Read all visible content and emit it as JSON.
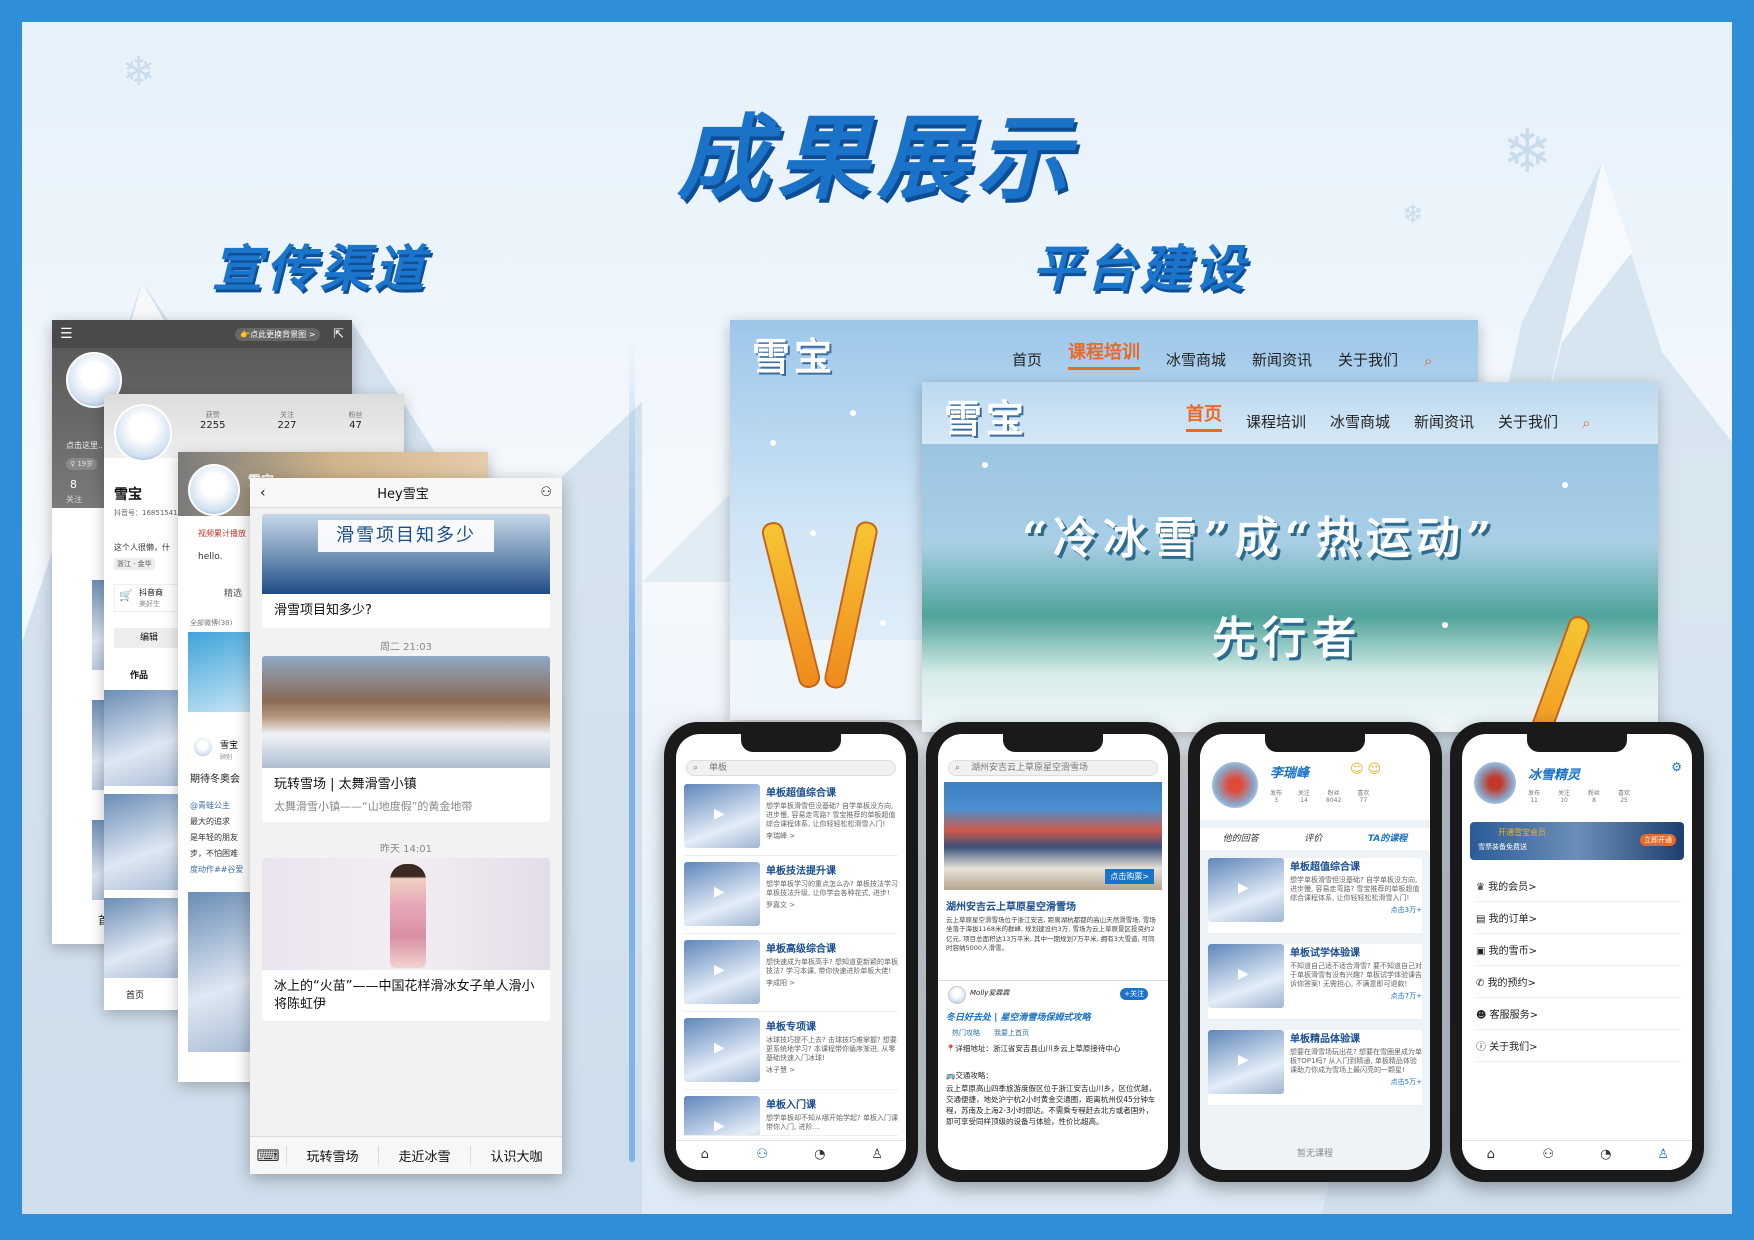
{
  "poster": {
    "main_title": "成果展示",
    "left_section_title": "宣传渠道",
    "right_section_title": "平台建设"
  },
  "social": {
    "profile1": {
      "menu_badge": "👉点此更换背景图 >",
      "hint": "点击这里...",
      "age": "♀ 19岁",
      "count": "8",
      "count_label": "关注",
      "nav_home": "首页"
    },
    "profile2": {
      "name": "雪宝",
      "id": "抖音号：16851541",
      "stats": [
        {
          "label": "获赞",
          "value": "2255"
        },
        {
          "label": "关注",
          "value": "227"
        },
        {
          "label": "粉丝",
          "value": "47"
        }
      ],
      "bio": "这个人很懒，什",
      "location": "浙江 · 金华",
      "shop": "抖音商",
      "shop_sub": "美好生",
      "edit": "编辑",
      "works": "作品",
      "nav_home": "首页"
    },
    "profile3": {
      "name": "雪宝",
      "badge": "视频累计播放",
      "hello": "hello.",
      "featured": "精选",
      "all_posts": "全部微博(38)",
      "post_name": "雪宝",
      "post_sub": "顾别",
      "post_line1": "期待冬奥会",
      "post_line2": "@青蛙公主",
      "post_line3": "最大的追求",
      "post_line4": "是年轻的朋友",
      "post_line5": "步，不怕困难",
      "post_line6": "度动作##谷爱"
    },
    "hey": {
      "title": "Hey雪宝",
      "article1_banner": "滑雪项目知多少",
      "article1_caption": "滑雪项目知多少?",
      "time1": "周二 21:03",
      "article2_caption": "玩转雪场 | 太舞滑雪小镇",
      "article2_sub": "太舞滑雪小镇——“山地度假”的黄金地带",
      "time2": "昨天 14:01",
      "article3_caption": "冰上的“火苗”——中国花样滑冰女子单人滑小将陈虹伊",
      "menus": [
        "玩转雪场",
        "走近冰雪",
        "认识大咖"
      ]
    }
  },
  "website_back": {
    "logo": "雪宝",
    "nav": [
      "首页",
      "课程培训",
      "冰雪商城",
      "新闻资讯",
      "关于我们"
    ],
    "active": "课程培训"
  },
  "website_front": {
    "logo": "雪宝",
    "nav": [
      "首页",
      "课程培训",
      "冰雪商城",
      "新闻资讯",
      "关于我们"
    ],
    "active": "首页",
    "hero_line1": "“冷冰雪”成“热运动”",
    "hero_line2": "先行者"
  },
  "phones": {
    "p1": {
      "search": "单板",
      "courses": [
        {
          "title": "单板超值综合课",
          "desc": "想学单板滑雪但没基础? 自学单板没方向, 进步慢, 容易走弯路? 雪宝推荐的单板超值综合课程体系, 让你轻轻松松滑雪入门!",
          "teacher": "李瑞峰 >"
        },
        {
          "title": "单板技法提升课",
          "desc": "想学单板学习的重点怎么办? 单板技法学习单板技法升级, 让你学会各种花式, 进步!",
          "teacher": "罗嘉文 >"
        },
        {
          "title": "单板高级综合课",
          "desc": "想快速成为单板高手? 想知道更新颖的单板技法? 学习本课, 带你快速进阶单板大佬!",
          "teacher": "李成阳 >"
        },
        {
          "title": "单板专项课",
          "desc": "冰球技巧提不上去? 击球技巧难掌握? 想要更系统地学习? 本课程带你循序渐进, 从零基础快速入门冰球!",
          "teacher": "冰子慧 >"
        },
        {
          "title": "单板入门课",
          "desc": "想学单板却不知从哪开始学起? 单板入门课带你入门, 进阶…",
          "teacher": ""
        }
      ]
    },
    "p2": {
      "search": "湖州安吉云上草原星空滑雪场",
      "buy": "点击购票>",
      "venue_title": "湖州安吉云上草原星空滑雪场",
      "venue_desc": "云上草原星空滑雪场位于浙江安吉, 距离湖杭都都的高山天然滑雪场, 雪场坐落于海拔1168米的群峰, 规划建设约3万, 雪场为云上草原景区投资约2亿元, 项目总面积达13万平米, 其中一期规划7万平米, 拥有3大雪道, 可同时容纳5000人滑雪。",
      "user": "Molly爱霖霖",
      "follow": "+关注",
      "post_title": "冬日好去处 | 星空滑雪场保姆式攻略",
      "tags": [
        "热门攻略",
        "我要上首页"
      ],
      "address": "📍详细地址：浙江省安吉县山川乡云上草原接待中心",
      "traffic": "🚌交通攻略：",
      "traffic_desc": "云上草原高山四季旅游度假区位于浙江安吉山川乡，区位优越，交通便捷，地处沪宁杭2小时黄金交通圈，距离杭州仅45分钟车程，苏南及上海2-3小时即达。不需乘专程赶去北方或者国外，即可享受同样顶级的设备与体验，性价比超高。"
    },
    "p3": {
      "name": "李瑞峰",
      "stats": [
        {
          "label": "发布",
          "value": "3"
        },
        {
          "label": "关注",
          "value": "14"
        },
        {
          "label": "粉丝",
          "value": "8042"
        },
        {
          "label": "喜欢",
          "value": "77"
        }
      ],
      "tabs": [
        "他的回答",
        "评价",
        "TA的课程"
      ],
      "courses": [
        {
          "title": "单板超值综合课",
          "desc": "想学单板滑雪但没基础? 自学单板没方向, 进步慢, 容易走弯路? 雪宝推荐的单板超值综合课程体系, 让你轻轻松松滑雪入门!",
          "tag": "点击3万+"
        },
        {
          "title": "单板试学体验课",
          "desc": "不知道自己适不适合滑雪? 要不知道自己对于单板滑雪有没有兴趣? 单板试学体验课告诉你答案! 无需担心, 不满意即可退款!",
          "tag": "点击7万+"
        },
        {
          "title": "单板精品体验课",
          "desc": "想要在滑雪场玩出花? 想要在雪圈里成为单板TOP1吗? 从入门到精通, 单板精品体验课助力你成为雪场上最闪亮的一颗星!",
          "tag": "点击5万+"
        }
      ],
      "empty": "暂无课程"
    },
    "p4": {
      "name": "冰雪精灵",
      "stats": [
        {
          "label": "发布",
          "value": "11"
        },
        {
          "label": "关注",
          "value": "10"
        },
        {
          "label": "粉丝",
          "value": "8"
        },
        {
          "label": "喜欢",
          "value": "25"
        }
      ],
      "vip_banner": "开通雪宝会员",
      "vip_sub": "雪票装备免费送",
      "vip_button": "立即开通",
      "menu": [
        "我的会员>",
        "我的订单>",
        "我的雪币>",
        "我的预约>",
        "客服服务>",
        "关于我们>"
      ]
    }
  },
  "colors": {
    "frame": "#2f8ed8",
    "title": "#1b72c9",
    "accent": "#e86a2a"
  }
}
